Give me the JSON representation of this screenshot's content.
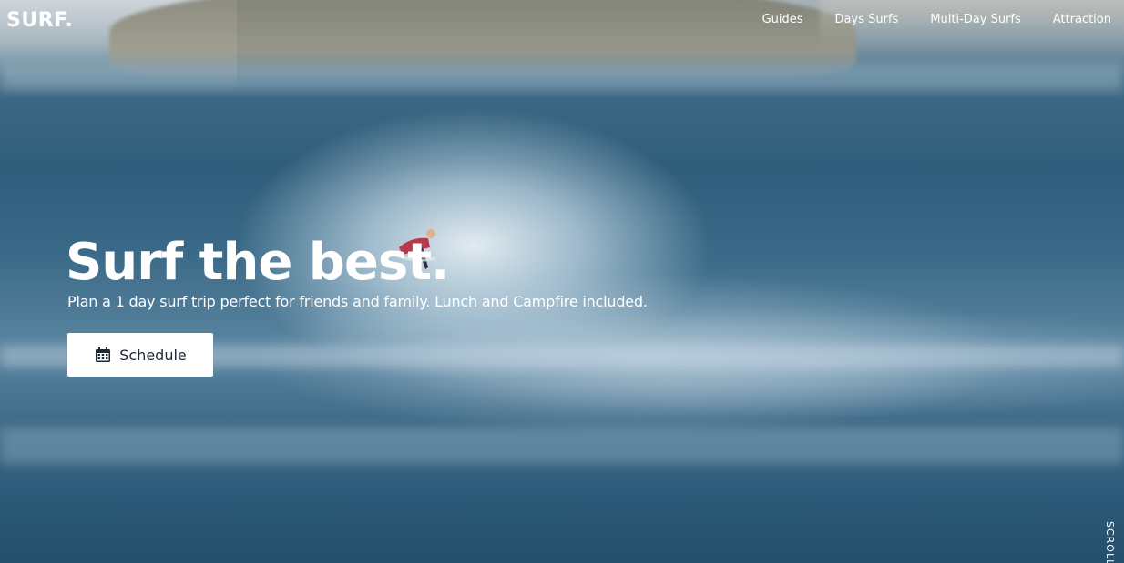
{
  "brand": {
    "logo": "SURF."
  },
  "nav": {
    "items": [
      {
        "label": "Guides"
      },
      {
        "label": "Days Surfs"
      },
      {
        "label": "Multi-Day Surfs"
      },
      {
        "label": "Attraction"
      }
    ]
  },
  "hero": {
    "headline": "Surf the best.",
    "subheadline": "Plan a 1 day surf trip perfect for friends and family. Lunch and Campfire included.",
    "cta": {
      "label": "Schedule",
      "icon": "calendar-icon"
    },
    "background_image": "surfer-riding-ocean-wave",
    "scroll_hint": "SCROLL"
  },
  "colors": {
    "text": "#ffffff",
    "button_bg": "#ffffff",
    "button_text": "#1d2a35",
    "ocean": "#2f5d7b"
  }
}
